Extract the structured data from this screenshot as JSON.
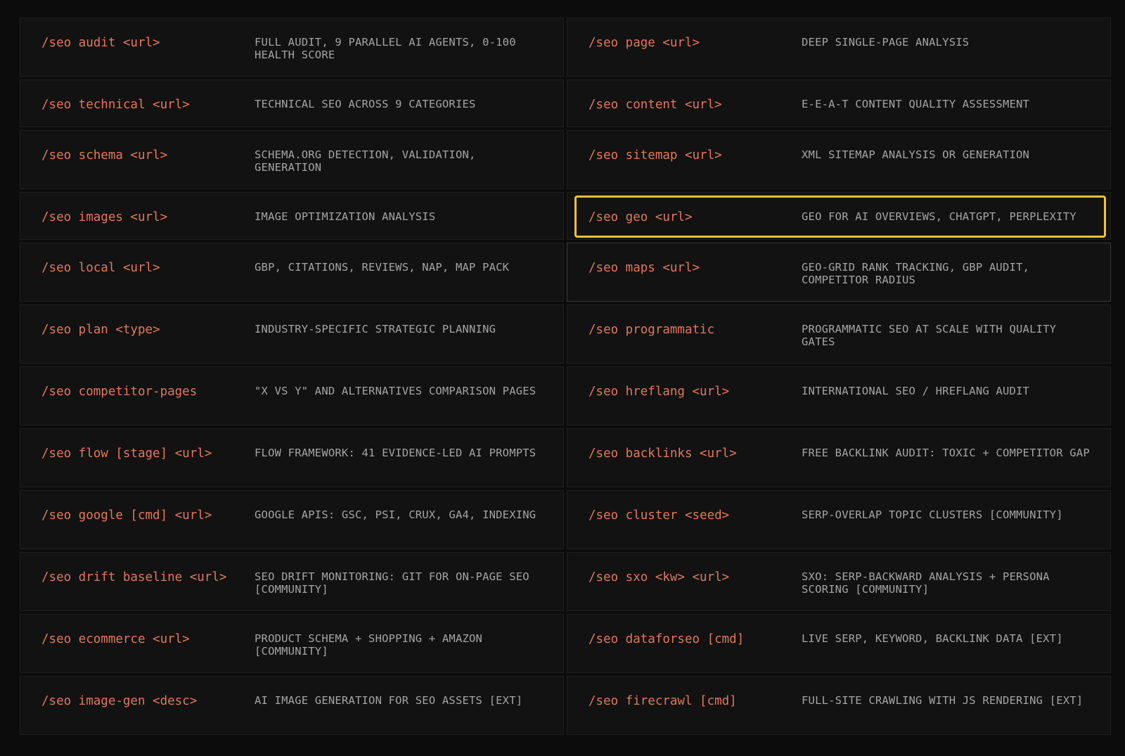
{
  "commands": [
    [
      {
        "cmd": "/seo audit <url>",
        "desc": "FULL AUDIT, 9 PARALLEL AI AGENTS, 0-100 HEALTH SCORE"
      },
      {
        "cmd": "/seo page <url>",
        "desc": "DEEP SINGLE-PAGE ANALYSIS"
      }
    ],
    [
      {
        "cmd": "/seo technical <url>",
        "desc": "TECHNICAL SEO ACROSS 9 CATEGORIES"
      },
      {
        "cmd": "/seo content <url>",
        "desc": "E-E-A-T CONTENT QUALITY ASSESSMENT"
      }
    ],
    [
      {
        "cmd": "/seo schema <url>",
        "desc": "SCHEMA.ORG DETECTION, VALIDATION, GENERATION"
      },
      {
        "cmd": "/seo sitemap <url>",
        "desc": "XML SITEMAP ANALYSIS OR GENERATION"
      }
    ],
    [
      {
        "cmd": "/seo images <url>",
        "desc": "IMAGE OPTIMIZATION ANALYSIS"
      },
      {
        "cmd": "/seo geo <url>",
        "desc": "GEO FOR AI OVERVIEWS, CHATGPT, PERPLEXITY"
      }
    ],
    [
      {
        "cmd": "/seo local <url>",
        "desc": "GBP, CITATIONS, REVIEWS, NAP, MAP PACK"
      },
      {
        "cmd": "/seo maps <url>",
        "desc": "GEO-GRID RANK TRACKING, GBP AUDIT, COMPETITOR RADIUS"
      }
    ],
    [
      {
        "cmd": "/seo plan <type>",
        "desc": "INDUSTRY-SPECIFIC STRATEGIC PLANNING"
      },
      {
        "cmd": "/seo programmatic",
        "desc": "PROGRAMMATIC SEO AT SCALE WITH QUALITY GATES"
      }
    ],
    [
      {
        "cmd": "/seo competitor-pages",
        "desc": "\"X VS Y\" AND ALTERNATIVES COMPARISON PAGES"
      },
      {
        "cmd": "/seo hreflang <url>",
        "desc": "INTERNATIONAL SEO / HREFLANG AUDIT"
      }
    ],
    [
      {
        "cmd": "/seo flow [stage] <url>",
        "desc": "FLOW FRAMEWORK: 41 EVIDENCE-LED AI PROMPTS"
      },
      {
        "cmd": "/seo backlinks <url>",
        "desc": "FREE BACKLINK AUDIT: TOXIC + COMPETITOR GAP"
      }
    ],
    [
      {
        "cmd": "/seo google [cmd] <url>",
        "desc": "GOOGLE APIS: GSC, PSI, CRUX, GA4, INDEXING"
      },
      {
        "cmd": "/seo cluster <seed>",
        "desc": "SERP-OVERLAP TOPIC CLUSTERS [COMMUNITY]"
      }
    ],
    [
      {
        "cmd": "/seo drift baseline <url>",
        "desc": "SEO DRIFT MONITORING: GIT FOR ON-PAGE SEO [COMMUNITY]"
      },
      {
        "cmd": "/seo sxo <kw> <url>",
        "desc": "SXO: SERP-BACKWARD ANALYSIS + PERSONA SCORING [COMMUNITY]"
      }
    ],
    [
      {
        "cmd": "/seo ecommerce <url>",
        "desc": "PRODUCT SCHEMA + SHOPPING + AMAZON [COMMUNITY]"
      },
      {
        "cmd": "/seo dataforseo [cmd]",
        "desc": "LIVE SERP, KEYWORD, BACKLINK DATA [EXT]"
      }
    ],
    [
      {
        "cmd": "/seo image-gen <desc>",
        "desc": "AI IMAGE GENERATION FOR SEO ASSETS [EXT]"
      },
      {
        "cmd": "/seo firecrawl [cmd]",
        "desc": "FULL-SITE CRAWLING WITH JS RENDERING [EXT]"
      }
    ]
  ],
  "highlighted": "/seo geo <url>",
  "colors": {
    "background": "#0c0c0c",
    "cell": "#121212",
    "command": "#e4775a",
    "description": "#a4a4a4",
    "highlight": "#f2c233"
  }
}
